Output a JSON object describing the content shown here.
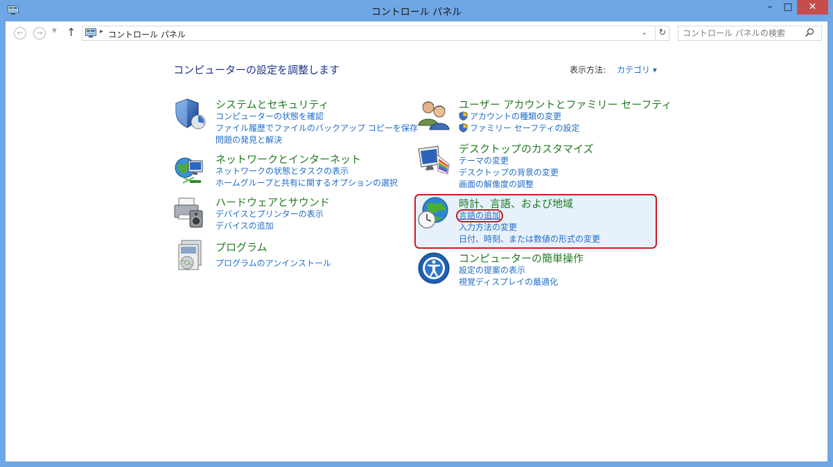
{
  "window": {
    "title": "コントロール パネル",
    "minimize": "–",
    "maximize": "□",
    "close": "✕"
  },
  "nav": {
    "back_icon": "back-arrow-icon",
    "forward_icon": "forward-arrow-icon",
    "up_icon": "up-arrow-icon",
    "breadcrumb": "コントロール パネル",
    "search_placeholder": "コントロール パネルの検索"
  },
  "main": {
    "heading": "コンピューターの設定を調整します",
    "view_by_label": "表示方法:",
    "view_by_value": "カテゴリ ▾",
    "categories_left": [
      {
        "title": "システムとセキュリティ",
        "links": [
          "コンピューターの状態を確認",
          "ファイル履歴でファイルのバックアップ コピーを保存",
          "問題の発見と解決"
        ]
      },
      {
        "title": "ネットワークとインターネット",
        "links": [
          "ネットワークの状態とタスクの表示",
          "ホームグループと共有に関するオプションの選択"
        ]
      },
      {
        "title": "ハードウェアとサウンド",
        "links": [
          "デバイスとプリンターの表示",
          "デバイスの追加"
        ]
      },
      {
        "title": "プログラム",
        "links": [
          "プログラムのアンインストール"
        ]
      }
    ],
    "categories_right": [
      {
        "title": "ユーザー アカウントとファミリー セーフティ",
        "links": [
          "アカウントの種類の変更",
          "ファミリー セーフティの設定"
        ]
      },
      {
        "title": "デスクトップのカスタマイズ",
        "links": [
          "テーマの変更",
          "デスクトップの背景の変更",
          "画面の解像度の調整"
        ]
      },
      {
        "title": "時計、言語、および地域",
        "links": [
          "言語の追加",
          "入力方法の変更",
          "日付、時刻、または数値の形式の変更"
        ]
      },
      {
        "title": "コンピューターの簡単操作",
        "links": [
          "設定の提案の表示",
          "視覚ディスプレイの最適化"
        ]
      }
    ]
  },
  "colors": {
    "frame": "#6fa6e5",
    "title_green": "#207a20",
    "link_blue": "#1e6cc8",
    "heading_blue": "#1e3287",
    "highlight_red": "#c8191e"
  }
}
